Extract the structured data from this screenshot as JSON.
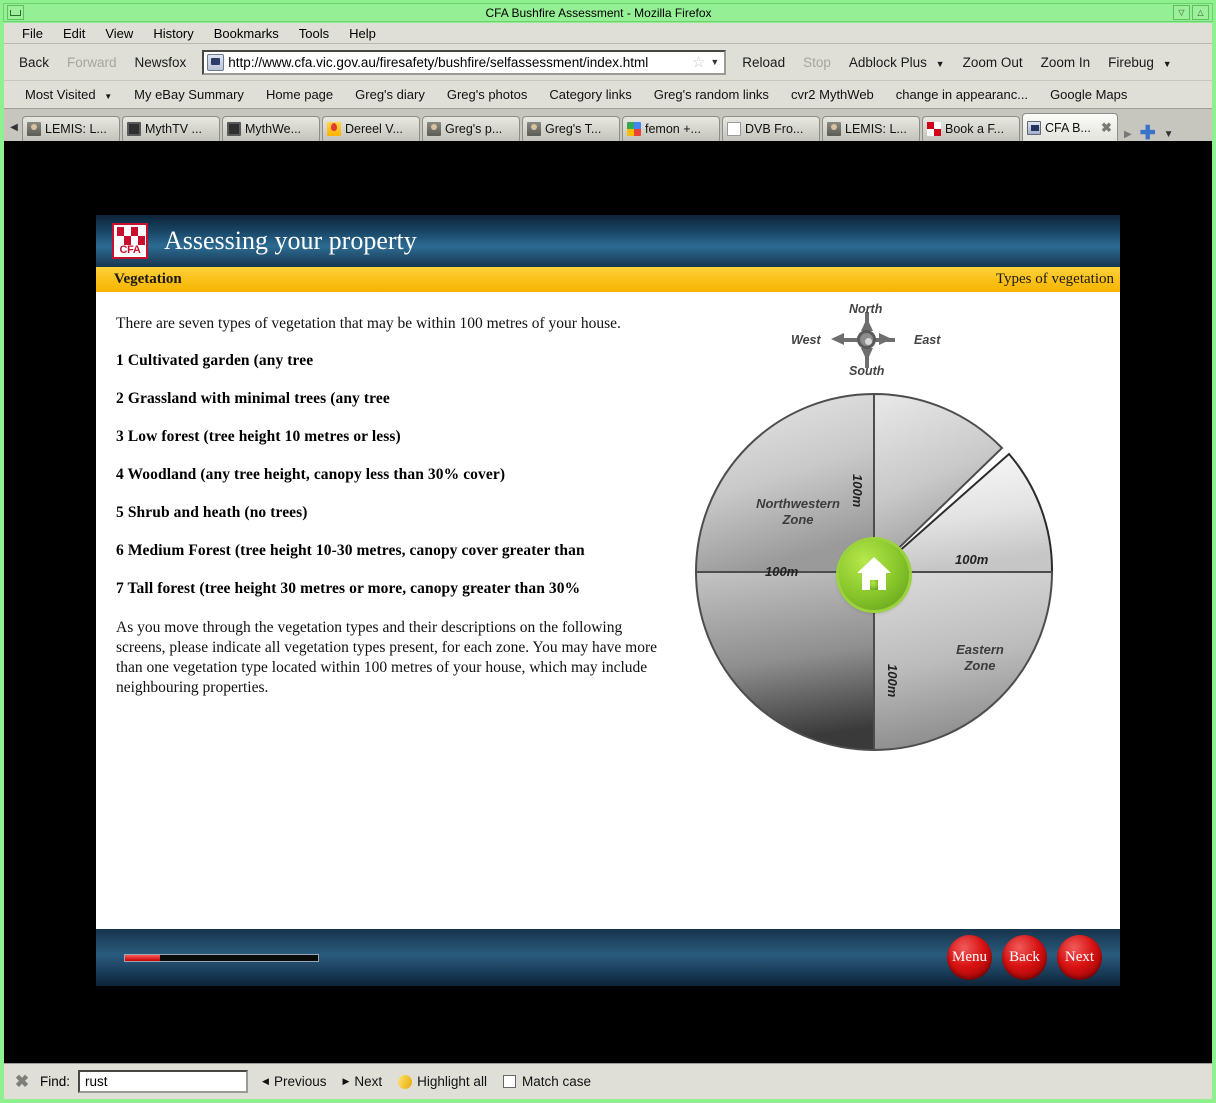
{
  "window": {
    "title": "CFA Bushfire Assessment - Mozilla Firefox",
    "minimize_label": "_",
    "restore_label": "▽",
    "close_label": "△"
  },
  "menubar": [
    {
      "label": "File",
      "accel": "F"
    },
    {
      "label": "Edit",
      "accel": "E"
    },
    {
      "label": "View",
      "accel": "V"
    },
    {
      "label": "History",
      "accel": "s"
    },
    {
      "label": "Bookmarks",
      "accel": "B"
    },
    {
      "label": "Tools",
      "accel": "T"
    },
    {
      "label": "Help",
      "accel": "H"
    }
  ],
  "toolbar": {
    "back_label": "Back",
    "forward_label": "Forward",
    "newsfox_label": "Newsfox",
    "url": "http://www.cfa.vic.gov.au/firesafety/bushfire/selfassessment/index.html",
    "star_glyph": "☆",
    "dropdown_glyph": "▼",
    "reload_label": "Reload",
    "stop_label": "Stop",
    "adblock_label": "Adblock Plus",
    "zoom_out_label": "Zoom Out",
    "zoom_in_label": "Zoom In",
    "firebug_label": "Firebug",
    "site_icon": "site-favicon-icon"
  },
  "bookmarks": [
    {
      "label": "Most Visited",
      "caret": "▼"
    },
    {
      "label": "My eBay Summary",
      "caret": ""
    },
    {
      "label": "Home page",
      "caret": ""
    },
    {
      "label": "Greg's diary",
      "caret": ""
    },
    {
      "label": "Greg's photos",
      "caret": ""
    },
    {
      "label": "Category links",
      "caret": ""
    },
    {
      "label": "Greg's random links",
      "caret": ""
    },
    {
      "label": "cvr2 MythWeb",
      "caret": ""
    },
    {
      "label": "change in appearanc...",
      "caret": ""
    },
    {
      "label": "Google Maps",
      "caret": ""
    }
  ],
  "tabs": {
    "scroll_left_glyph": "◀",
    "scroll_right_glyph": "▶",
    "new_tab_glyph": "✚",
    "list_all_glyph": "▼",
    "close_glyph": "✖",
    "items": [
      {
        "label": "LEMIS: L...",
        "favicon": "person-icon",
        "active": false
      },
      {
        "label": "MythTV ...",
        "favicon": "monitor-icon",
        "active": false
      },
      {
        "label": "MythWe...",
        "favicon": "monitor-icon",
        "active": false
      },
      {
        "label": "Dereel V...",
        "favicon": "map-pin-icon",
        "active": false
      },
      {
        "label": "Greg's p...",
        "favicon": "person-icon",
        "active": false
      },
      {
        "label": "Greg's T...",
        "favicon": "person-icon",
        "active": false
      },
      {
        "label": "femon +...",
        "favicon": "google-icon",
        "active": false
      },
      {
        "label": "DVB Fro...",
        "favicon": "document-icon",
        "active": false
      },
      {
        "label": "LEMIS: L...",
        "favicon": "person-icon",
        "active": false
      },
      {
        "label": "Book a F...",
        "favicon": "checker-red-icon",
        "active": false
      },
      {
        "label": "CFA B...",
        "favicon": "cfa-icon",
        "active": true
      }
    ]
  },
  "courseware": {
    "logo_text": "CFA",
    "title": "Assessing your property",
    "subbar_left": "Vegetation",
    "subbar_right": "Types of vegetation",
    "intro": "There are seven types of vegetation that may be within 100 metres of your house.",
    "vegetation_types": [
      "1 Cultivated garden (any tree",
      "2 Grassland with minimal trees (any tree",
      "3 Low forest (tree height 10 metres or less)",
      "4 Woodland (any tree height, canopy less than 30% cover)",
      "5 Shrub and heath (no trees)",
      "6 Medium Forest (tree height 10-30 metres, canopy cover greater than",
      "7 Tall forest (tree height 30 metres or more, canopy greater than 30%"
    ],
    "outro": "As you move through the vegetation types and their descriptions on the following screens, please indicate all vegetation types present, for each zone.  You may have more than one vegetation type located within 100 metres of your house, which may include neighbouring properties.",
    "compass": {
      "north": "North",
      "south": "South",
      "east": "East",
      "west": "West"
    },
    "diagram": {
      "zone_nw": "Northwestern\nZone",
      "zone_nw_line1": "Northwestern",
      "zone_nw_line2": "Zone",
      "zone_e_line1": "Eastern",
      "zone_e_line2": "Zone",
      "dist_top": "100m",
      "dist_bottom": "100m",
      "dist_left": "100m",
      "dist_right": "100m",
      "house_icon": "house-icon"
    },
    "footer": {
      "progress_percent": 18,
      "menu_label": "Menu",
      "back_label": "Back",
      "next_label": "Next"
    }
  },
  "findbar": {
    "close_glyph": "✖",
    "label": "Find:",
    "value": "rust",
    "placeholder": "",
    "previous_label": "Previous",
    "previous_glyph": "◀",
    "next_label": "Next",
    "next_glyph": "▶",
    "highlight_label": "Highlight all",
    "match_case_label": "Match case",
    "match_case_checked": false
  },
  "colors": {
    "window_chrome": "#8ef08e",
    "toolbar_bg": "#dfdfd8",
    "header_blue": "#1b4a6b",
    "subbar_yellow": "#fbc11b",
    "button_red": "#d81212",
    "house_green": "#86c42a"
  }
}
